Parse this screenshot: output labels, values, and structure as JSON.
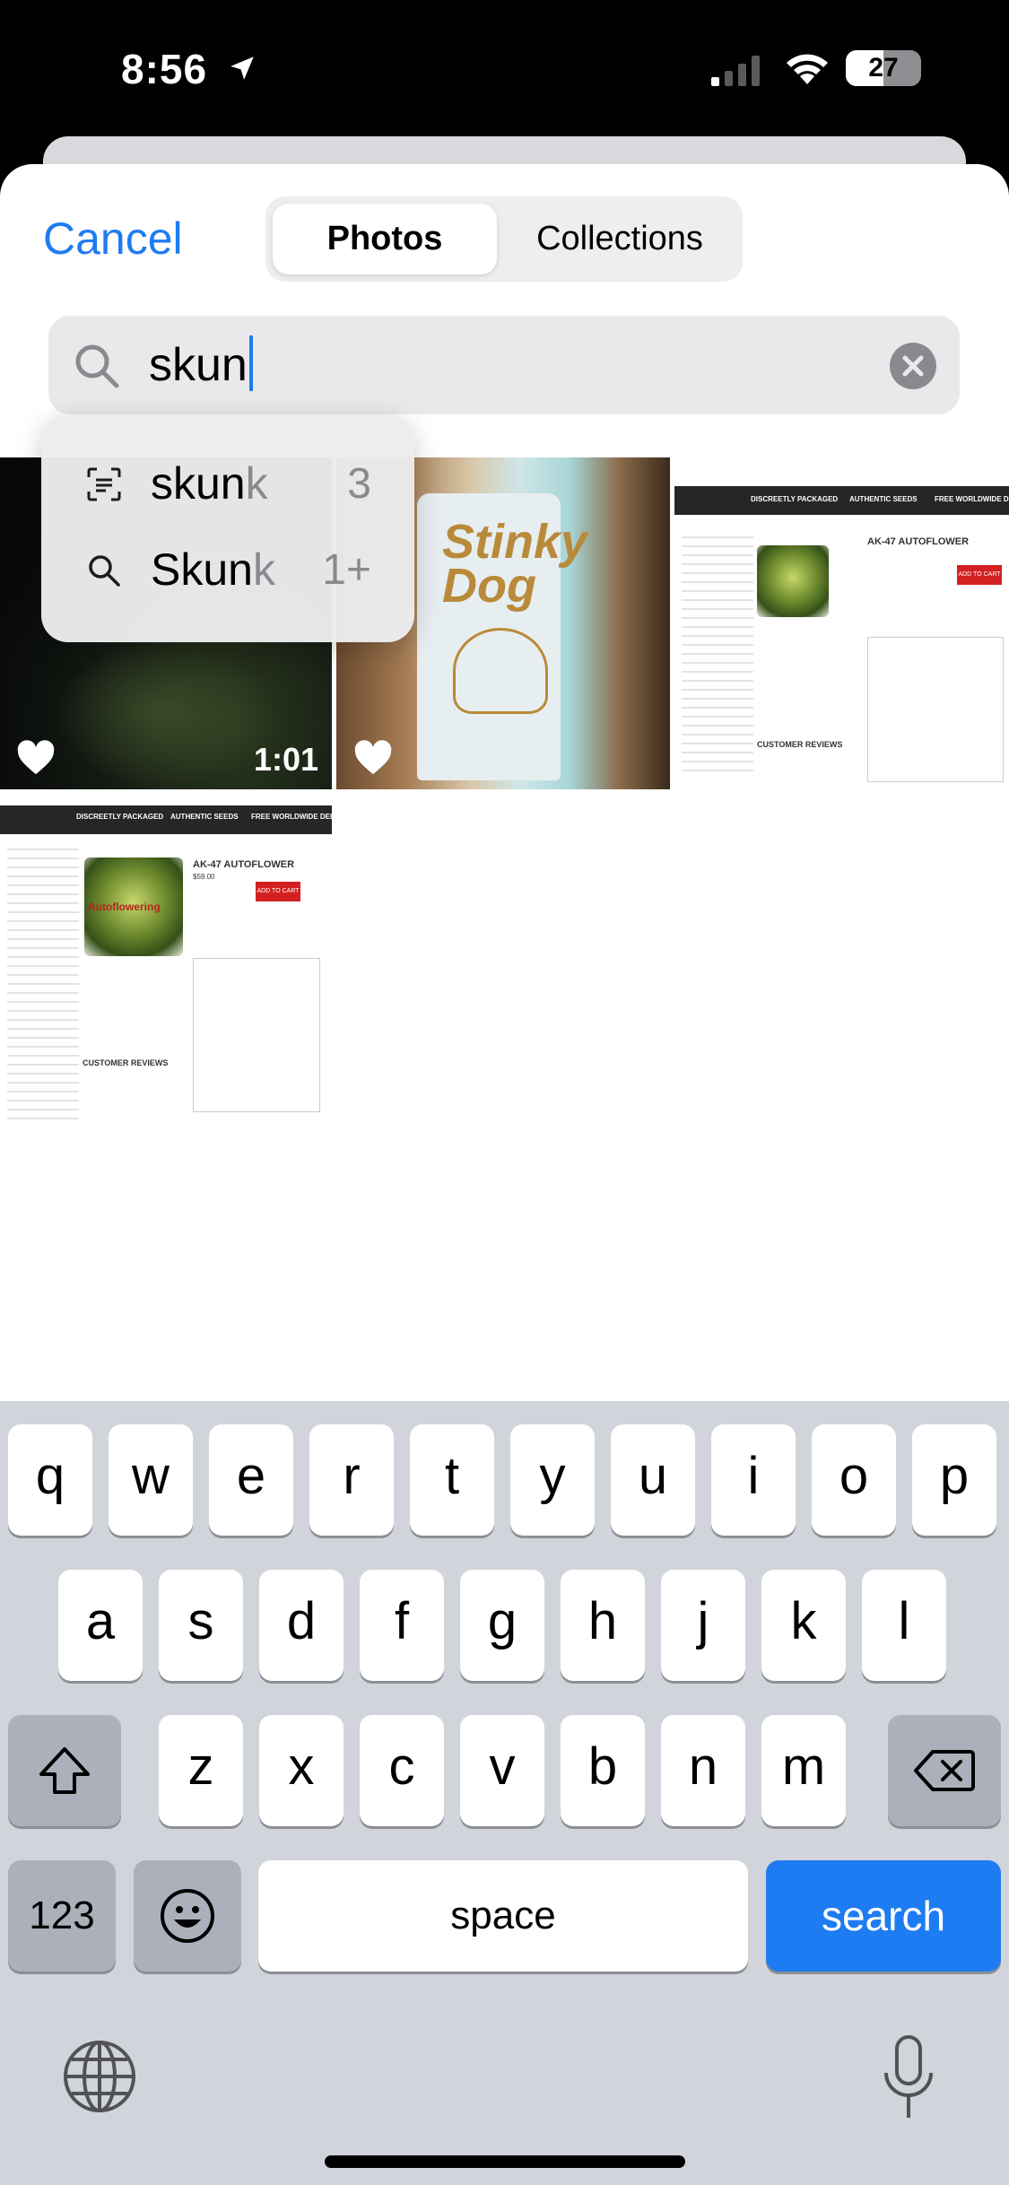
{
  "status_bar": {
    "time": "8:56",
    "battery": "27"
  },
  "header": {
    "cancel": "Cancel",
    "tabs": [
      {
        "label": "Photos",
        "selected": true
      },
      {
        "label": "Collections",
        "selected": false
      }
    ]
  },
  "search": {
    "value": "skun"
  },
  "suggestions": [
    {
      "icon": "text-scan-icon",
      "typed": "skun",
      "completion": "k",
      "count": "3"
    },
    {
      "icon": "search-icon",
      "typed": "Skun",
      "completion": "k",
      "count": "1+"
    }
  ],
  "photos": [
    {
      "kind": "video",
      "favorite": true,
      "duration": "1:01"
    },
    {
      "kind": "photo",
      "favorite": true,
      "visible_text": "Stinky Dog"
    },
    {
      "kind": "screenshot",
      "favorite": false,
      "visible_text": "AK-47 AUTOFLOWER"
    },
    {
      "kind": "screenshot",
      "favorite": false,
      "visible_text": "AK-47 AUTOFLOWER"
    }
  ],
  "screenshot_text": {
    "tabs": [
      "DISCREETLY PACKAGED",
      "AUTHENTIC SEEDS",
      "FREE WORLDWIDE DELIVERY"
    ],
    "product": "AK-47 AUTOFLOWER",
    "price": "$59.00",
    "cart": "ADD TO CART",
    "reviews": "CUSTOMER REVIEWS",
    "brand": "Autoflowering"
  },
  "keyboard": {
    "row1": [
      "q",
      "w",
      "e",
      "r",
      "t",
      "y",
      "u",
      "i",
      "o",
      "p"
    ],
    "row2": [
      "a",
      "s",
      "d",
      "f",
      "g",
      "h",
      "j",
      "k",
      "l"
    ],
    "row3": [
      "z",
      "x",
      "c",
      "v",
      "b",
      "n",
      "m"
    ],
    "numbers": "123",
    "space": "space",
    "return": "search"
  },
  "colors": {
    "accent": "#1E7CF2",
    "keyboard_bg": "#D2D4DB"
  }
}
